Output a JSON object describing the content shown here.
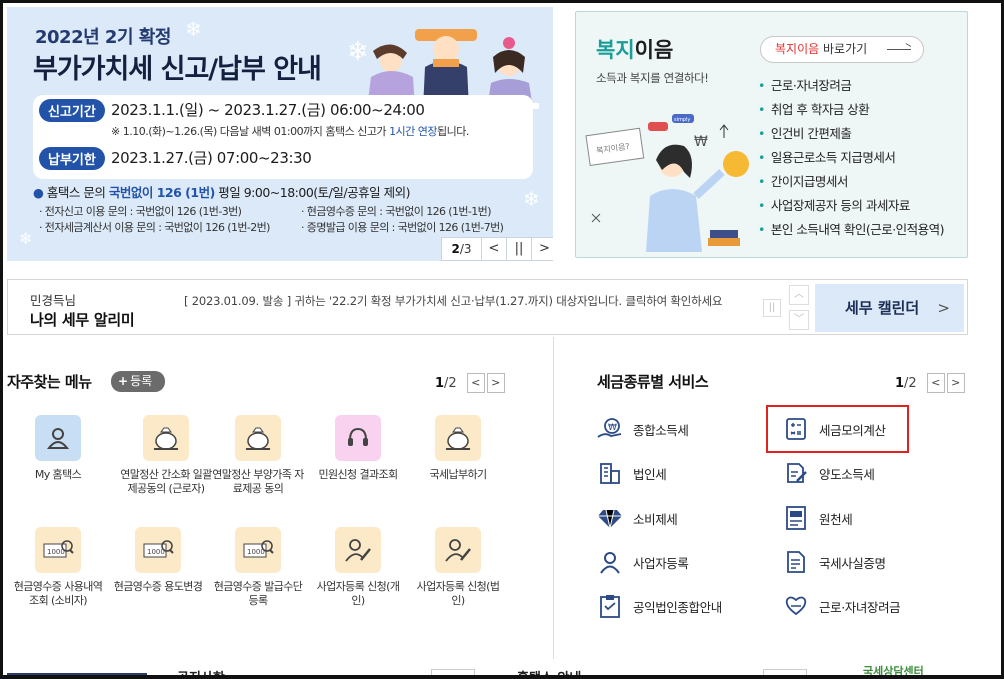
{
  "banner": {
    "title_line1": "2022년 2기 확정",
    "title_line2": "부가가치세 신고/납부 안내",
    "filing_label": "신고기간",
    "filing_period": "2023.1.1.(일) ~ 2023.1.27.(금) 06:00~24:00",
    "filing_note_prefix": "※ 1.10.(화)~1.26.(목) 다음날 새벽 01:00까지 홈택스 신고가 ",
    "filing_note_highlight": "1시간 연장",
    "filing_note_suffix": "됩니다.",
    "payment_label": "납부기한",
    "payment_period": "2023.1.27.(금) 07:00~23:30",
    "inquiry_prefix": "홈택스 문의 ",
    "inquiry_number": "국번없이 126 (1번)",
    "inquiry_hours": " 평일 9:00~18:00(토/일/공휴일 제외)",
    "sub_inquiries": [
      "· 전자신고 이용 문의 : 국번없이 126 (1번-3번)",
      "· 현금영수증 문의 : 국번없이 126 (1번-1번)",
      "· 전자세금계산서 이용 문의 : 국번없이 126 (1번-2번)",
      "· 증명발급 이용 문의 : 국번없이 126 (1번-7번)"
    ],
    "page_current": "2",
    "page_total": "/3",
    "prev_symbol": "<",
    "pause_symbol": "||",
    "next_symbol": ">"
  },
  "welfare": {
    "title_teal": "복지",
    "title_rest": "이음",
    "subtitle": "소득과 복지를 연결하다!",
    "go_red": "복지이음",
    "go_rest": " 바로가기",
    "items": [
      "근로·자녀장려금",
      "취업 후 학자금 상환",
      "인건비 간편제출",
      "일용근로소득 지급명세서",
      "간이지급명세서",
      "사업장제공자 등의 과세자료",
      "본인 소득내역 확인(근로·인적용역)"
    ],
    "illustration_sign": "복지이음?",
    "illustration_tag": "simply",
    "illustration_coin": "₩"
  },
  "notice": {
    "user_name": "민경득님",
    "title": "나의 세무 알리미",
    "message": "[ 2023.01.09. 발송 ] 귀하는 '22.2기 확정 부가가치세 신고·납부(1.27.까지) 대상자입니다. 클릭하여 확인하세요",
    "pause_symbol": "||",
    "up_symbol": "︿",
    "down_symbol": "﹀",
    "calendar_label": "세무 캘린더",
    "calendar_chevron": ">"
  },
  "favorites": {
    "title": "자주찾는 메뉴",
    "register_plus": "+",
    "register_label": "등록",
    "page_current": "1",
    "page_total": "/2",
    "prev_symbol": "<",
    "next_symbol": ">",
    "items": [
      {
        "label": "My 홈택스",
        "icon": "user-icon"
      },
      {
        "label": "연말정산 간소화 일괄제공동의 (근로자)",
        "icon": "money-bag-icon"
      },
      {
        "label": "연말정산 부양가족 자료제공 동의",
        "icon": "money-bag-icon"
      },
      {
        "label": "민원신청 결과조회",
        "icon": "headset-icon"
      },
      {
        "label": "국세납부하기",
        "icon": "money-bag-icon"
      },
      {
        "label": "현금영수증 사용내역조회 (소비자)",
        "icon": "receipt-search-icon"
      },
      {
        "label": "현금영수증 용도변경",
        "icon": "receipt-search-icon"
      },
      {
        "label": "현금영수증 발급수단 등록",
        "icon": "receipt-search-icon"
      },
      {
        "label": "사업자등록 신청(개인)",
        "icon": "person-pen-icon"
      },
      {
        "label": "사업자등록 신청(법인)",
        "icon": "person-pen-icon"
      }
    ]
  },
  "tax_services": {
    "title": "세금종류별 서비스",
    "page_current": "1",
    "page_total": "/2",
    "prev_symbol": "<",
    "next_symbol": ">",
    "items": [
      {
        "label": "종합소득세",
        "icon": "won-hand-icon"
      },
      {
        "label": "세금모의계산",
        "icon": "calculator-icon"
      },
      {
        "label": "법인세",
        "icon": "building-icon"
      },
      {
        "label": "양도소득세",
        "icon": "document-pen-icon"
      },
      {
        "label": "소비제세",
        "icon": "diamond-icon"
      },
      {
        "label": "원천세",
        "icon": "salary-doc-icon"
      },
      {
        "label": "사업자등록",
        "icon": "person-icon"
      },
      {
        "label": "국세사실증명",
        "icon": "certificate-icon"
      },
      {
        "label": "공익법인종합안내",
        "icon": "clipboard-icon"
      },
      {
        "label": "근로·자녀장려금",
        "icon": "heart-hands-icon"
      }
    ]
  },
  "bottom": {
    "notice_title": "공지사항",
    "guide_title": "홈택스 안내",
    "logo_text": "국세상담센터"
  },
  "colors": {
    "accent_blue": "#2253a8",
    "teal": "#1a9e9a",
    "highlight_red": "#e02222"
  }
}
